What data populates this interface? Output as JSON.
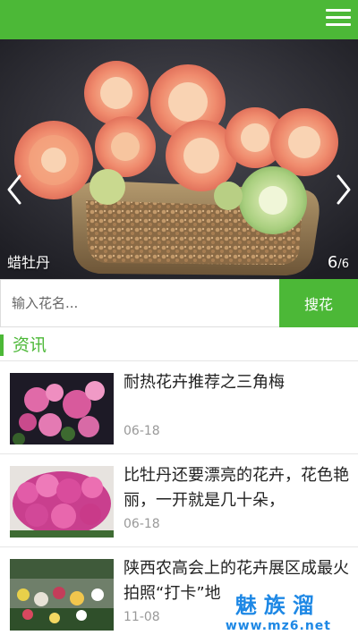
{
  "header": {
    "menu_icon": "hamburger-menu-icon",
    "bg_color": "#4cb837"
  },
  "banner": {
    "caption": "蜡牡丹",
    "counter_current": "6",
    "counter_total": "/6",
    "prev_icon": "chevron-left-icon",
    "next_icon": "chevron-right-icon"
  },
  "search": {
    "placeholder": "输入花名...",
    "button_label": "搜花"
  },
  "section": {
    "title": "资讯"
  },
  "news": [
    {
      "title": "耐热花卉推荐之三角梅",
      "date": "06-18"
    },
    {
      "title": "比牡丹还要漂亮的花卉，花色艳丽，一开就是几十朵，",
      "date": "06-18"
    },
    {
      "title": "陕西农高会上的花卉展区成最火拍照“打卡”地",
      "date": "11-08"
    }
  ],
  "watermark": {
    "brand": "魅族溜",
    "url": "www.mz6.net"
  }
}
